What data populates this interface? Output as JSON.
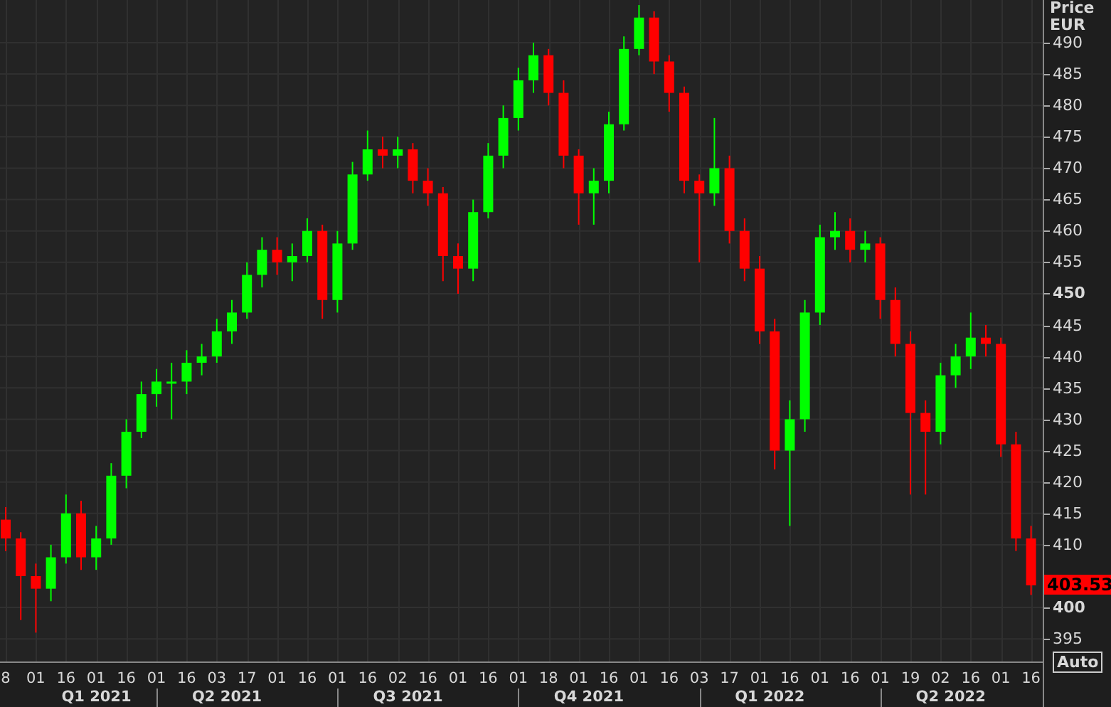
{
  "axis_header": {
    "title": "Price",
    "currency": "EUR"
  },
  "chart_data": {
    "type": "candlestick",
    "ylim": [
      391.4,
      496.8
    ],
    "yticks": [
      395,
      400,
      410,
      415,
      420,
      425,
      430,
      435,
      440,
      445,
      450,
      455,
      460,
      465,
      470,
      475,
      480,
      485,
      490
    ],
    "categories": [
      "8",
      null,
      "01",
      null,
      "16",
      null,
      "01",
      null,
      "16",
      null,
      "01",
      null,
      "16",
      null,
      "03",
      null,
      "17",
      null,
      "01",
      null,
      "16",
      null,
      "01",
      null,
      "16",
      null,
      "02",
      null,
      "16",
      null,
      "01",
      null,
      "16",
      null,
      "01",
      null,
      "18",
      null,
      "01",
      null,
      "16",
      null,
      "01",
      null,
      "16",
      null,
      "03",
      null,
      "17",
      null,
      "01",
      null,
      "16",
      null,
      "01",
      null,
      "16",
      null,
      "01",
      null,
      "19",
      null,
      "02",
      null,
      "16",
      null,
      "01",
      null,
      "16"
    ],
    "ohlc": [
      [
        414,
        416,
        409,
        411
      ],
      [
        411,
        412,
        398,
        405
      ],
      [
        405,
        407,
        396,
        403
      ],
      [
        403,
        410,
        401,
        408
      ],
      [
        408,
        418,
        407,
        415
      ],
      [
        415,
        417,
        406,
        408
      ],
      [
        408,
        413,
        406,
        411
      ],
      [
        411,
        423,
        410,
        421
      ],
      [
        421,
        430,
        419,
        428
      ],
      [
        428,
        436,
        427,
        434
      ],
      [
        434,
        438,
        432,
        436
      ],
      [
        436,
        439,
        430,
        436
      ],
      [
        436,
        441,
        434,
        439
      ],
      [
        439,
        442,
        437,
        440
      ],
      [
        440,
        446,
        439,
        444
      ],
      [
        444,
        449,
        442,
        447
      ],
      [
        447,
        455,
        446,
        453
      ],
      [
        453,
        459,
        451,
        457
      ],
      [
        457,
        459,
        453,
        455
      ],
      [
        455,
        458,
        452,
        456
      ],
      [
        456,
        462,
        455,
        460
      ],
      [
        460,
        461,
        446,
        449
      ],
      [
        449,
        460,
        447,
        458
      ],
      [
        458,
        471,
        457,
        469
      ],
      [
        469,
        476,
        468,
        473
      ],
      [
        473,
        475,
        470,
        472
      ],
      [
        472,
        475,
        470,
        473
      ],
      [
        473,
        474,
        466,
        468
      ],
      [
        468,
        470,
        464,
        466
      ],
      [
        466,
        467,
        452,
        456
      ],
      [
        456,
        458,
        450,
        454
      ],
      [
        454,
        465,
        452,
        463
      ],
      [
        463,
        474,
        462,
        472
      ],
      [
        472,
        480,
        470,
        478
      ],
      [
        478,
        486,
        476,
        484
      ],
      [
        484,
        490,
        482,
        488
      ],
      [
        488,
        489,
        480,
        482
      ],
      [
        482,
        484,
        470,
        472
      ],
      [
        472,
        473,
        461,
        466
      ],
      [
        466,
        470,
        461,
        468
      ],
      [
        468,
        479,
        466,
        477
      ],
      [
        477,
        491,
        476,
        489
      ],
      [
        489,
        496,
        488,
        494
      ],
      [
        494,
        495,
        485,
        487
      ],
      [
        487,
        488,
        479,
        482
      ],
      [
        482,
        483,
        466,
        468
      ],
      [
        468,
        469,
        455,
        466
      ],
      [
        466,
        478,
        464,
        470
      ],
      [
        470,
        472,
        458,
        460
      ],
      [
        460,
        462,
        452,
        454
      ],
      [
        454,
        456,
        442,
        444
      ],
      [
        444,
        446,
        422,
        425
      ],
      [
        425,
        433,
        413,
        430
      ],
      [
        430,
        449,
        428,
        447
      ],
      [
        447,
        461,
        445,
        459
      ],
      [
        459,
        463,
        457,
        460
      ],
      [
        460,
        462,
        455,
        457
      ],
      [
        457,
        460,
        455,
        458
      ],
      [
        458,
        459,
        446,
        449
      ],
      [
        449,
        451,
        440,
        442
      ],
      [
        442,
        444,
        418,
        431
      ],
      [
        431,
        433,
        418,
        428
      ],
      [
        428,
        439,
        426,
        437
      ],
      [
        437,
        442,
        435,
        440
      ],
      [
        440,
        447,
        438,
        443
      ],
      [
        443,
        445,
        440,
        442
      ],
      [
        442,
        443,
        424,
        426
      ],
      [
        426,
        428,
        409,
        411
      ],
      [
        411,
        413,
        402,
        403.53
      ]
    ],
    "grid": true,
    "annotations": [
      "Q1 2021",
      "Q2 2021",
      "Q3 2021",
      "Q4 2021",
      "Q1 2022",
      "Q2 2022"
    ]
  },
  "last_price": "403.53",
  "auto_button": "Auto"
}
